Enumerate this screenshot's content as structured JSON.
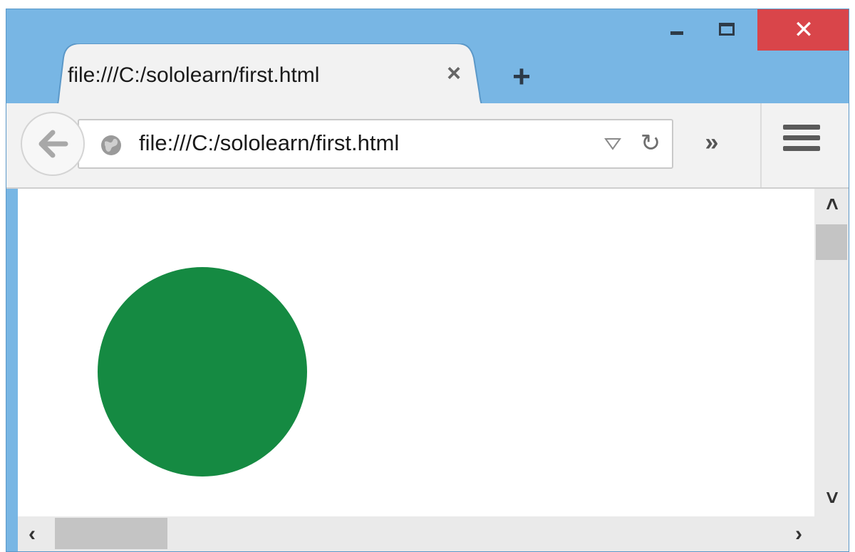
{
  "window": {
    "controls": {
      "minimize_icon": "minimize-icon",
      "maximize_icon": "maximize-icon",
      "close_icon": "close-icon",
      "close_color": "#d9454a"
    }
  },
  "tab": {
    "title": "file:///C:/sololearn/first.html",
    "close_glyph": "×",
    "new_tab_glyph": "+"
  },
  "toolbar": {
    "url": "file:///C:/sololearn/first.html",
    "reload_glyph": "↻",
    "overflow_glyph": "»"
  },
  "content": {
    "shape": "circle",
    "circle_color": "#158a42"
  },
  "colors": {
    "titlebar": "#78b6e4",
    "toolbar": "#f2f2f2"
  }
}
